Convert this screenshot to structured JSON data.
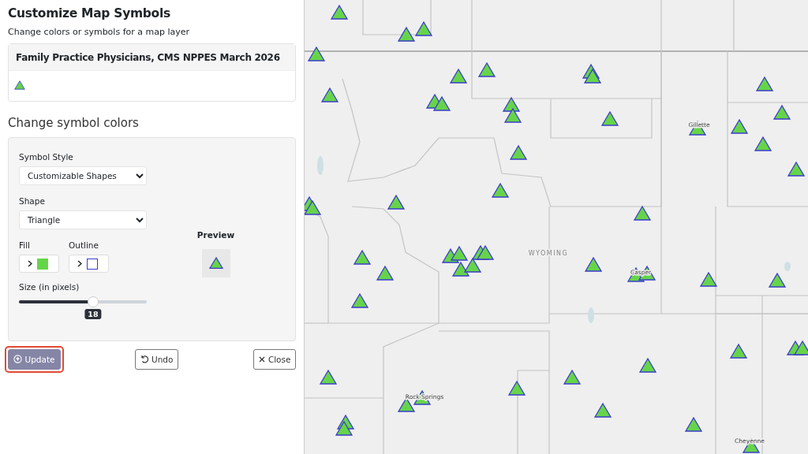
{
  "panel": {
    "title": "Customize Map Symbols",
    "subtitle": "Change colors or symbols for a map layer",
    "layer": {
      "name": "Family Practice Physicians, CMS NPPES March 2026"
    },
    "section_title": "Change symbol colors",
    "symbol_style": {
      "label": "Symbol Style",
      "value": "Customizable Shapes"
    },
    "shape": {
      "label": "Shape",
      "value": "Triangle"
    },
    "fill": {
      "label": "Fill",
      "color": "#66d44a"
    },
    "outline": {
      "label": "Outline",
      "color": "#3b3bcc"
    },
    "size": {
      "label": "Size (in pixels)",
      "level": 0.58,
      "reading": "18"
    },
    "preview": {
      "label": "Preview"
    },
    "buttons": [
      {
        "kind": "update",
        "label": "Update",
        "highlighted": true
      },
      {
        "kind": "undo",
        "label": "Undo",
        "highlighted": false
      },
      {
        "kind": "close",
        "label": "Close",
        "highlighted": false
      }
    ]
  },
  "map": {
    "labels": [
      {
        "text": "WYOMING",
        "kind": "state"
      },
      {
        "text": "Gillette",
        "kind": "city"
      },
      {
        "text": "Casper",
        "kind": "city"
      },
      {
        "text": "Rock Springs",
        "kind": "city"
      },
      {
        "text": "Cheyenne",
        "kind": "city"
      }
    ]
  }
}
